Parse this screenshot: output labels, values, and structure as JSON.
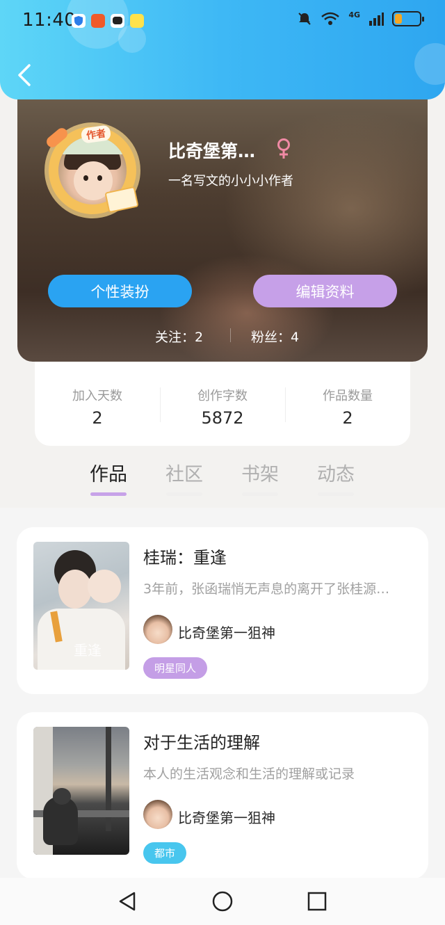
{
  "status_bar": {
    "time": "11:40",
    "network": "4G",
    "battery_level": 0.3
  },
  "header": {
    "back_icon": "chevron-left-icon"
  },
  "profile": {
    "badge": "作者",
    "username": "比奇堡第…",
    "gender_icon": "female-icon",
    "bio": "一名写文的小小小作者",
    "outfit_button": "个性装扮",
    "edit_button": "编辑资料",
    "following": "关注：2",
    "followers": "粉丝：4"
  },
  "stats": [
    {
      "label": "加入天数",
      "value": "2"
    },
    {
      "label": "创作字数",
      "value": "5872"
    },
    {
      "label": "作品数量",
      "value": "2"
    }
  ],
  "tabs": [
    {
      "label": "作品",
      "active": true
    },
    {
      "label": "社区",
      "active": false
    },
    {
      "label": "书架",
      "active": false
    },
    {
      "label": "动态",
      "active": false
    }
  ],
  "works": [
    {
      "title": "桂瑞：重逢",
      "description": "3年前，张函瑞悄无声息的离开了张桂源…",
      "author": "比奇堡第一狙神",
      "tag": "明星同人",
      "cover_text": "重逢"
    },
    {
      "title": "对于生活的理解",
      "description": "本人的生活观念和生活的理解或记录",
      "author": "比奇堡第一狙神",
      "tag": "都市"
    }
  ],
  "nav": {
    "back": "triangle-back-icon",
    "home": "circle-home-icon",
    "recents": "square-recents-icon"
  },
  "colors": {
    "header": "#3eb8f5",
    "outfit_button": "#2aa3f2",
    "edit_button": "#c6a0e8",
    "active_tab_bar": "#c7a2e8"
  }
}
